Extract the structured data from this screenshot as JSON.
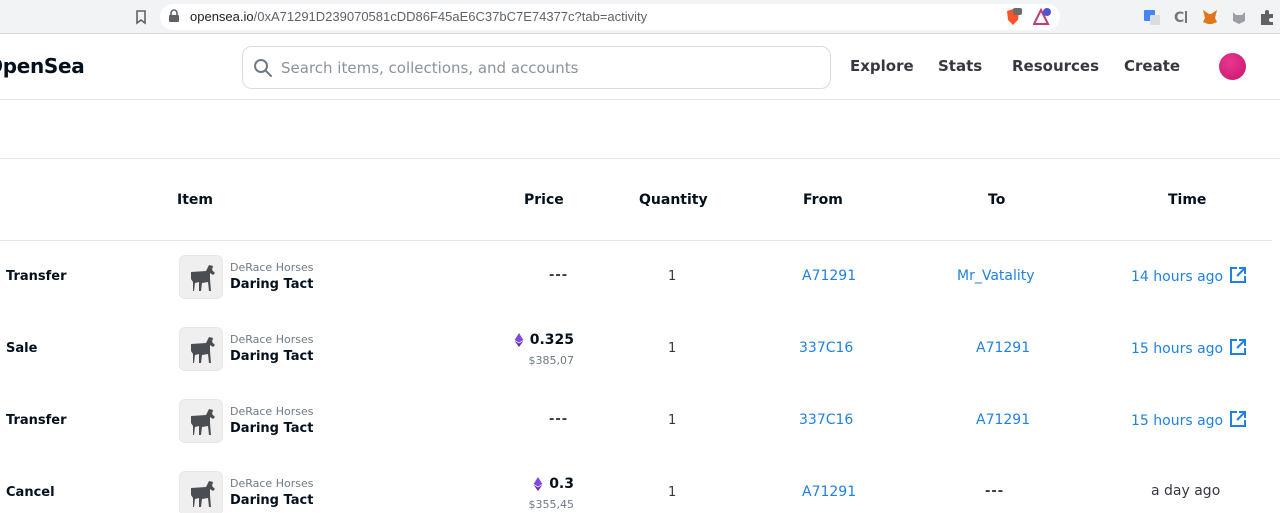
{
  "browser": {
    "url_domain": "opensea.io",
    "url_path": "/0xA71291D239070581cDD86F45aE6C37bC7E74377c?tab=activity"
  },
  "header": {
    "brand": "OpenSea",
    "search_placeholder": "Search items, collections, and accounts",
    "nav": {
      "explore": "Explore",
      "stats": "Stats",
      "resources": "Resources",
      "create": "Create"
    }
  },
  "table": {
    "headers": {
      "item": "Item",
      "price": "Price",
      "quantity": "Quantity",
      "from": "From",
      "to": "To",
      "time": "Time"
    },
    "rows": [
      {
        "event": "Transfer",
        "collection": "DeRace Horses",
        "item": "Daring Tact",
        "price_placeholder": "---",
        "quantity": "1",
        "from": "A71291",
        "to": "Mr_Vatality",
        "time": "14 hours ago"
      },
      {
        "event": "Sale",
        "collection": "DeRace Horses",
        "item": "Daring Tact",
        "price_eth": "0.325",
        "price_usd": "$385,07",
        "quantity": "1",
        "from": "337C16",
        "to": "A71291",
        "time": "15 hours ago"
      },
      {
        "event": "Transfer",
        "collection": "DeRace Horses",
        "item": "Daring Tact",
        "price_placeholder": "---",
        "quantity": "1",
        "from": "337C16",
        "to": "A71291",
        "time": "15 hours ago"
      },
      {
        "event": "Cancel",
        "collection": "DeRace Horses",
        "item": "Daring Tact",
        "price_eth": "0.3",
        "price_usd": "$355,45",
        "quantity": "1",
        "from": "A71291",
        "to_placeholder": "---",
        "time": "a day ago"
      }
    ]
  },
  "colors": {
    "link": "#2081e2",
    "text": "#04111d",
    "muted": "#707a83",
    "avatar": "#d81b7a"
  }
}
